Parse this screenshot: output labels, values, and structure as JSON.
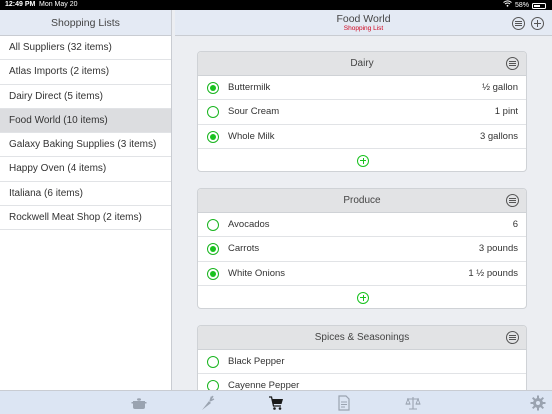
{
  "status_bar": {
    "time": "12:49 PM",
    "date": "Mon May 20",
    "battery": "58%",
    "battery_level": 0.58
  },
  "sidebar": {
    "title": "Shopping Lists",
    "items": [
      {
        "label": "All Suppliers (32 items)"
      },
      {
        "label": "Atlas Imports (2 items)"
      },
      {
        "label": "Dairy Direct (5 items)"
      },
      {
        "label": "Food World (10 items)",
        "selected": true
      },
      {
        "label": "Galaxy Baking Supplies (3 items)"
      },
      {
        "label": "Happy Oven (4 items)"
      },
      {
        "label": "Italiana (6 items)"
      },
      {
        "label": "Rockwell Meat Shop (2 items)"
      }
    ]
  },
  "header": {
    "title": "Food World",
    "subtitle": "Shopping List"
  },
  "sections": [
    {
      "title": "Dairy",
      "items": [
        {
          "name": "Buttermilk",
          "qty": "½ gallon",
          "checked": true
        },
        {
          "name": "Sour Cream",
          "qty": "1 pint",
          "checked": false
        },
        {
          "name": "Whole Milk",
          "qty": "3 gallons",
          "checked": true
        }
      ]
    },
    {
      "title": "Produce",
      "items": [
        {
          "name": "Avocados",
          "qty": "6",
          "checked": false
        },
        {
          "name": "Carrots",
          "qty": "3 pounds",
          "checked": true
        },
        {
          "name": "White Onions",
          "qty": "1 ½ pounds",
          "checked": true
        }
      ]
    },
    {
      "title": "Spices & Seasonings",
      "items": [
        {
          "name": "Black Pepper",
          "qty": "",
          "checked": false
        },
        {
          "name": "Cayenne Pepper",
          "qty": "",
          "checked": false
        }
      ]
    }
  ],
  "tabbar": {
    "tabs": [
      {
        "icon": "pot-icon",
        "active": false
      },
      {
        "icon": "carrot-icon",
        "active": false
      },
      {
        "icon": "cart-icon",
        "active": true
      },
      {
        "icon": "document-icon",
        "active": false
      },
      {
        "icon": "scale-icon",
        "active": false
      }
    ],
    "settings_icon": "gear-icon"
  },
  "colors": {
    "check_green": "#19c21f",
    "subtitle_red": "#d0021b",
    "bar_blue": "#dce5f3",
    "active_tab": "#1a1a1a",
    "inactive_tab": "#9aa3b0"
  }
}
